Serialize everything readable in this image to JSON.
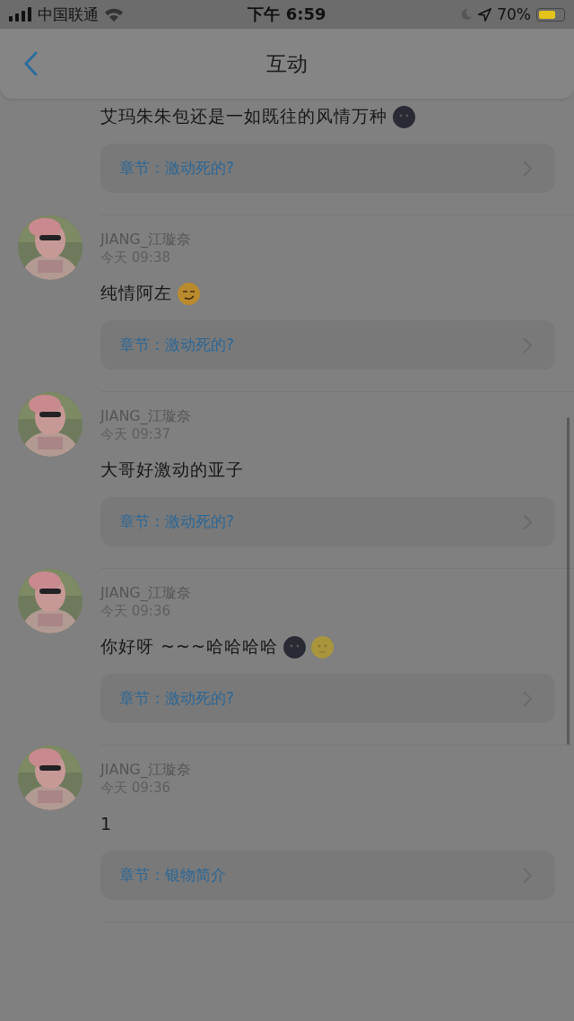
{
  "status_bar": {
    "carrier": "中国联通",
    "time": "下午 6:59",
    "battery": "70%"
  },
  "nav": {
    "title": "互动"
  },
  "comments": [
    {
      "kind": "partial",
      "text": "艾玛朱朱包还是一如既往的风情万种",
      "emojis": [
        {
          "kind": "moon"
        }
      ],
      "chapter": "章节：激动死的?"
    },
    {
      "kind": "full",
      "user": "JIANG_江璇奈",
      "time": "今天 09:38",
      "text": "纯情阿左",
      "emojis": [
        {
          "kind": "smirk"
        }
      ],
      "chapter": "章节：激动死的?"
    },
    {
      "kind": "full",
      "user": "JIANG_江璇奈",
      "time": "今天 09:37",
      "text": "大哥好激动的亚子",
      "chapter": "章节：激动死的?"
    },
    {
      "kind": "full",
      "user": "JIANG_江璇奈",
      "time": "今天 09:36",
      "text": "你好呀 ~~~哈哈哈哈",
      "emojis": [
        {
          "kind": "moon"
        },
        {
          "kind": "moon-face"
        }
      ],
      "chapter": "章节：激动死的?"
    },
    {
      "kind": "full",
      "user": "JIANG_江璇奈",
      "time": "今天 09:36",
      "text": "1",
      "chapter": "章节：银物简介"
    }
  ]
}
